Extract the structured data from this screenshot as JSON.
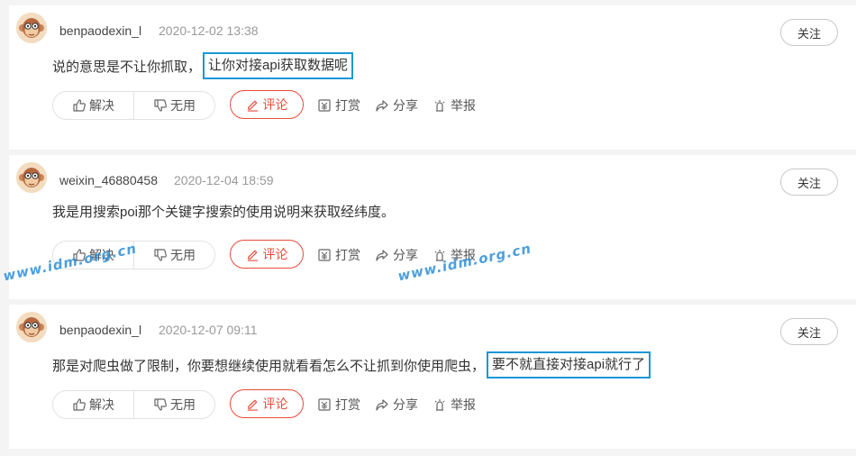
{
  "comments": [
    {
      "username": "benpaodexin_l",
      "time": "2020-12-02 13:38",
      "follow_label": "关注",
      "text_plain": "说的意思是不让你抓取，",
      "text_highlight": "让你对接api获取数据呢"
    },
    {
      "username": "weixin_46880458",
      "time": "2020-12-04 18:59",
      "follow_label": "关注",
      "text_plain": "我是用搜索poi那个关键字搜索的使用说明来获取经纬度。",
      "text_highlight": ""
    },
    {
      "username": "benpaodexin_l",
      "time": "2020-12-07 09:11",
      "follow_label": "关注",
      "text_plain": "那是对爬虫做了限制，你要想继续使用就看看怎么不让抓到你使用爬虫，",
      "text_highlight": "要不就直接对接api就行了"
    }
  ],
  "actions": {
    "helpful": "解决",
    "unhelpful": "无用",
    "reply": "评论",
    "reward": "打赏",
    "share": "分享",
    "report": "举报"
  },
  "watermark": "www.idm.org.cn",
  "colors": {
    "highlight_border": "#1a97d5",
    "reply_accent": "#e84c3d",
    "watermark": "#2f8fd8"
  }
}
